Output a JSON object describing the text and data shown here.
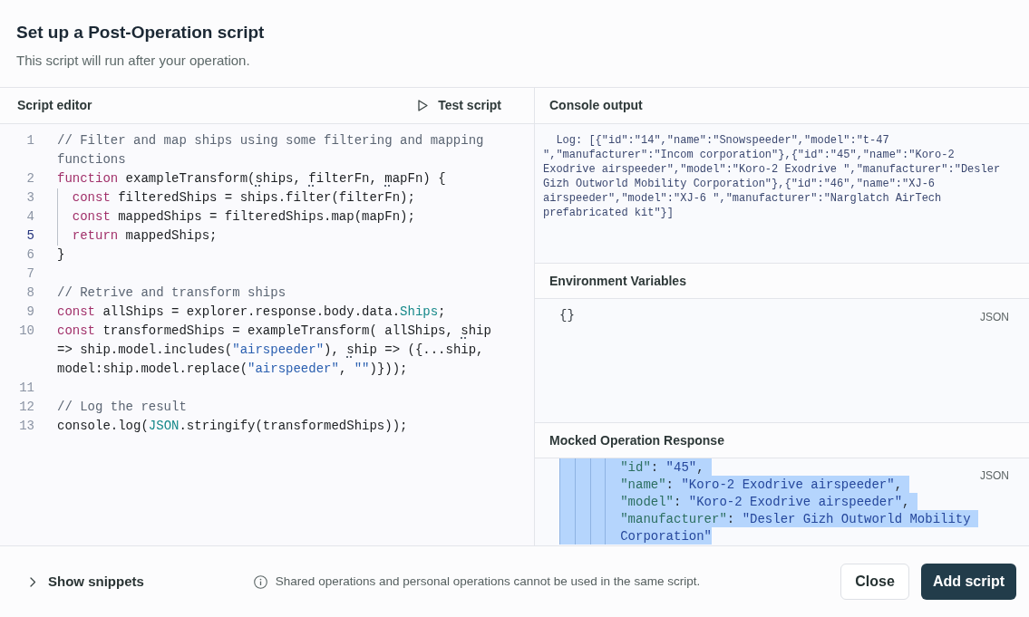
{
  "dialog": {
    "title": "Set up a Post-Operation script",
    "subtitle": "This script will run after your operation."
  },
  "editor": {
    "title": "Script editor",
    "test_button": "Test script",
    "lines": [
      {
        "number": "1",
        "active": false,
        "tokens": [
          {
            "kind": "comment",
            "text": "// Filter and map ships using some filtering and mapping functions"
          }
        ]
      },
      {
        "number": "2",
        "active": false,
        "tokens": [
          {
            "kind": "keyword",
            "text": "function"
          },
          {
            "kind": "plain",
            "text": " exampleTransform("
          },
          {
            "kind": "hint",
            "text": "s"
          },
          {
            "kind": "plain",
            "text": "hips, "
          },
          {
            "kind": "hint",
            "text": "f"
          },
          {
            "kind": "plain",
            "text": "ilterFn, "
          },
          {
            "kind": "hint",
            "text": "m"
          },
          {
            "kind": "plain",
            "text": "apFn) {"
          }
        ]
      },
      {
        "number": "3",
        "active": false,
        "tokens": [
          {
            "kind": "indent"
          },
          {
            "kind": "keyword",
            "text": "const"
          },
          {
            "kind": "plain",
            "text": " filteredShips = ships.filter(filterFn);"
          }
        ]
      },
      {
        "number": "4",
        "active": false,
        "tokens": [
          {
            "kind": "indent"
          },
          {
            "kind": "keyword",
            "text": "const"
          },
          {
            "kind": "plain",
            "text": " mappedShips = filteredShips.map(mapFn);"
          }
        ]
      },
      {
        "number": "5",
        "active": true,
        "tokens": [
          {
            "kind": "indent"
          },
          {
            "kind": "keyword",
            "text": "return"
          },
          {
            "kind": "plain",
            "text": " mappedShips;"
          }
        ]
      },
      {
        "number": "6",
        "active": false,
        "tokens": [
          {
            "kind": "plain",
            "text": "}"
          }
        ]
      },
      {
        "number": "7",
        "active": false
      },
      {
        "number": "8",
        "active": false,
        "tokens": [
          {
            "kind": "comment",
            "text": "// Retrive and transform ships"
          }
        ]
      },
      {
        "number": "9",
        "active": false,
        "tokens": [
          {
            "kind": "keyword",
            "text": "const"
          },
          {
            "kind": "plain",
            "text": " allShips = explorer.response.body.data."
          },
          {
            "kind": "type",
            "text": "Ships"
          },
          {
            "kind": "plain",
            "text": ";"
          }
        ]
      },
      {
        "number": "10",
        "active": false,
        "tokens": [
          {
            "kind": "keyword",
            "text": "const"
          },
          {
            "kind": "plain",
            "text": " transformedShips = exampleTransform( allShips, "
          },
          {
            "kind": "hint",
            "text": "s"
          },
          {
            "kind": "plain",
            "text": "hip => ship.model.includes("
          },
          {
            "kind": "string",
            "text": "\"airspeeder\""
          },
          {
            "kind": "plain",
            "text": "), "
          },
          {
            "kind": "hint",
            "text": "s"
          },
          {
            "kind": "plain",
            "text": "hip => ({...ship, model:ship.model.replace("
          },
          {
            "kind": "string",
            "text": "\"airspeeder\""
          },
          {
            "kind": "plain",
            "text": ", "
          },
          {
            "kind": "string",
            "text": "\"\""
          },
          {
            "kind": "plain",
            "text": ")}));"
          }
        ]
      },
      {
        "number": "11",
        "active": false
      },
      {
        "number": "12",
        "active": false,
        "tokens": [
          {
            "kind": "comment",
            "text": "// Log the result"
          }
        ]
      },
      {
        "number": "13",
        "active": false,
        "tokens": [
          {
            "kind": "plain",
            "text": "console.log("
          },
          {
            "kind": "type",
            "text": "JSON"
          },
          {
            "kind": "plain",
            "text": ".stringify(transformedShips));"
          }
        ]
      }
    ]
  },
  "console": {
    "title": "Console output",
    "text": "Log: [{\"id\":\"14\",\"name\":\"Snowspeeder\",\"model\":\"t-47 \",\"manufacturer\":\"Incom corporation\"},{\"id\":\"45\",\"name\":\"Koro-2 Exodrive airspeeder\",\"model\":\"Koro-2 Exodrive \",\"manufacturer\":\"Desler Gizh Outworld Mobility Corporation\"},{\"id\":\"46\",\"name\":\"XJ-6 airspeeder\",\"model\":\"XJ-6 \",\"manufacturer\":\"Narglatch AirTech prefabricated kit\"}]"
  },
  "environment": {
    "title": "Environment Variables",
    "value": "{}",
    "language": "JSON"
  },
  "mocked_response": {
    "title": "Mocked Operation Response",
    "language": "JSON",
    "lines": [
      {
        "selected": true,
        "tokens": [
          {
            "kind": "indent"
          },
          {
            "kind": "indent"
          },
          {
            "kind": "indent"
          },
          {
            "kind": "indent"
          },
          {
            "kind": "key",
            "text": "\"id\""
          },
          {
            "kind": "punct",
            "text": ": "
          },
          {
            "kind": "string",
            "text": "\"45\""
          },
          {
            "kind": "punct",
            "text": ", "
          }
        ]
      },
      {
        "selected": true,
        "tokens": [
          {
            "kind": "indent"
          },
          {
            "kind": "indent"
          },
          {
            "kind": "indent"
          },
          {
            "kind": "indent"
          },
          {
            "kind": "key",
            "text": "\"name\""
          },
          {
            "kind": "punct",
            "text": ": "
          },
          {
            "kind": "string",
            "text": "\"Koro-2 Exodrive airspeeder\""
          },
          {
            "kind": "punct",
            "text": ", "
          }
        ]
      },
      {
        "selected": true,
        "tokens": [
          {
            "kind": "indent"
          },
          {
            "kind": "indent"
          },
          {
            "kind": "indent"
          },
          {
            "kind": "indent"
          },
          {
            "kind": "key",
            "text": "\"model\""
          },
          {
            "kind": "punct",
            "text": ": "
          },
          {
            "kind": "string",
            "text": "\"Koro-2 Exodrive airspeeder\""
          },
          {
            "kind": "punct",
            "text": ", "
          }
        ]
      },
      {
        "selected": true,
        "tokens": [
          {
            "kind": "indent"
          },
          {
            "kind": "indent"
          },
          {
            "kind": "indent"
          },
          {
            "kind": "indent"
          },
          {
            "kind": "key",
            "text": "\"manufacturer\""
          },
          {
            "kind": "punct",
            "text": ": "
          },
          {
            "kind": "string",
            "text": "\"Desler Gizh Outworld Mobility Corporation\""
          }
        ]
      }
    ]
  },
  "footer": {
    "snippets_toggle": {
      "label": "Show snippets",
      "expanded": false
    },
    "notice": "Shared operations and personal operations cannot be used in the same script.",
    "buttons": [
      {
        "label": "Close",
        "kind": "secondary"
      },
      {
        "label": "Add script",
        "kind": "primary"
      }
    ]
  }
}
